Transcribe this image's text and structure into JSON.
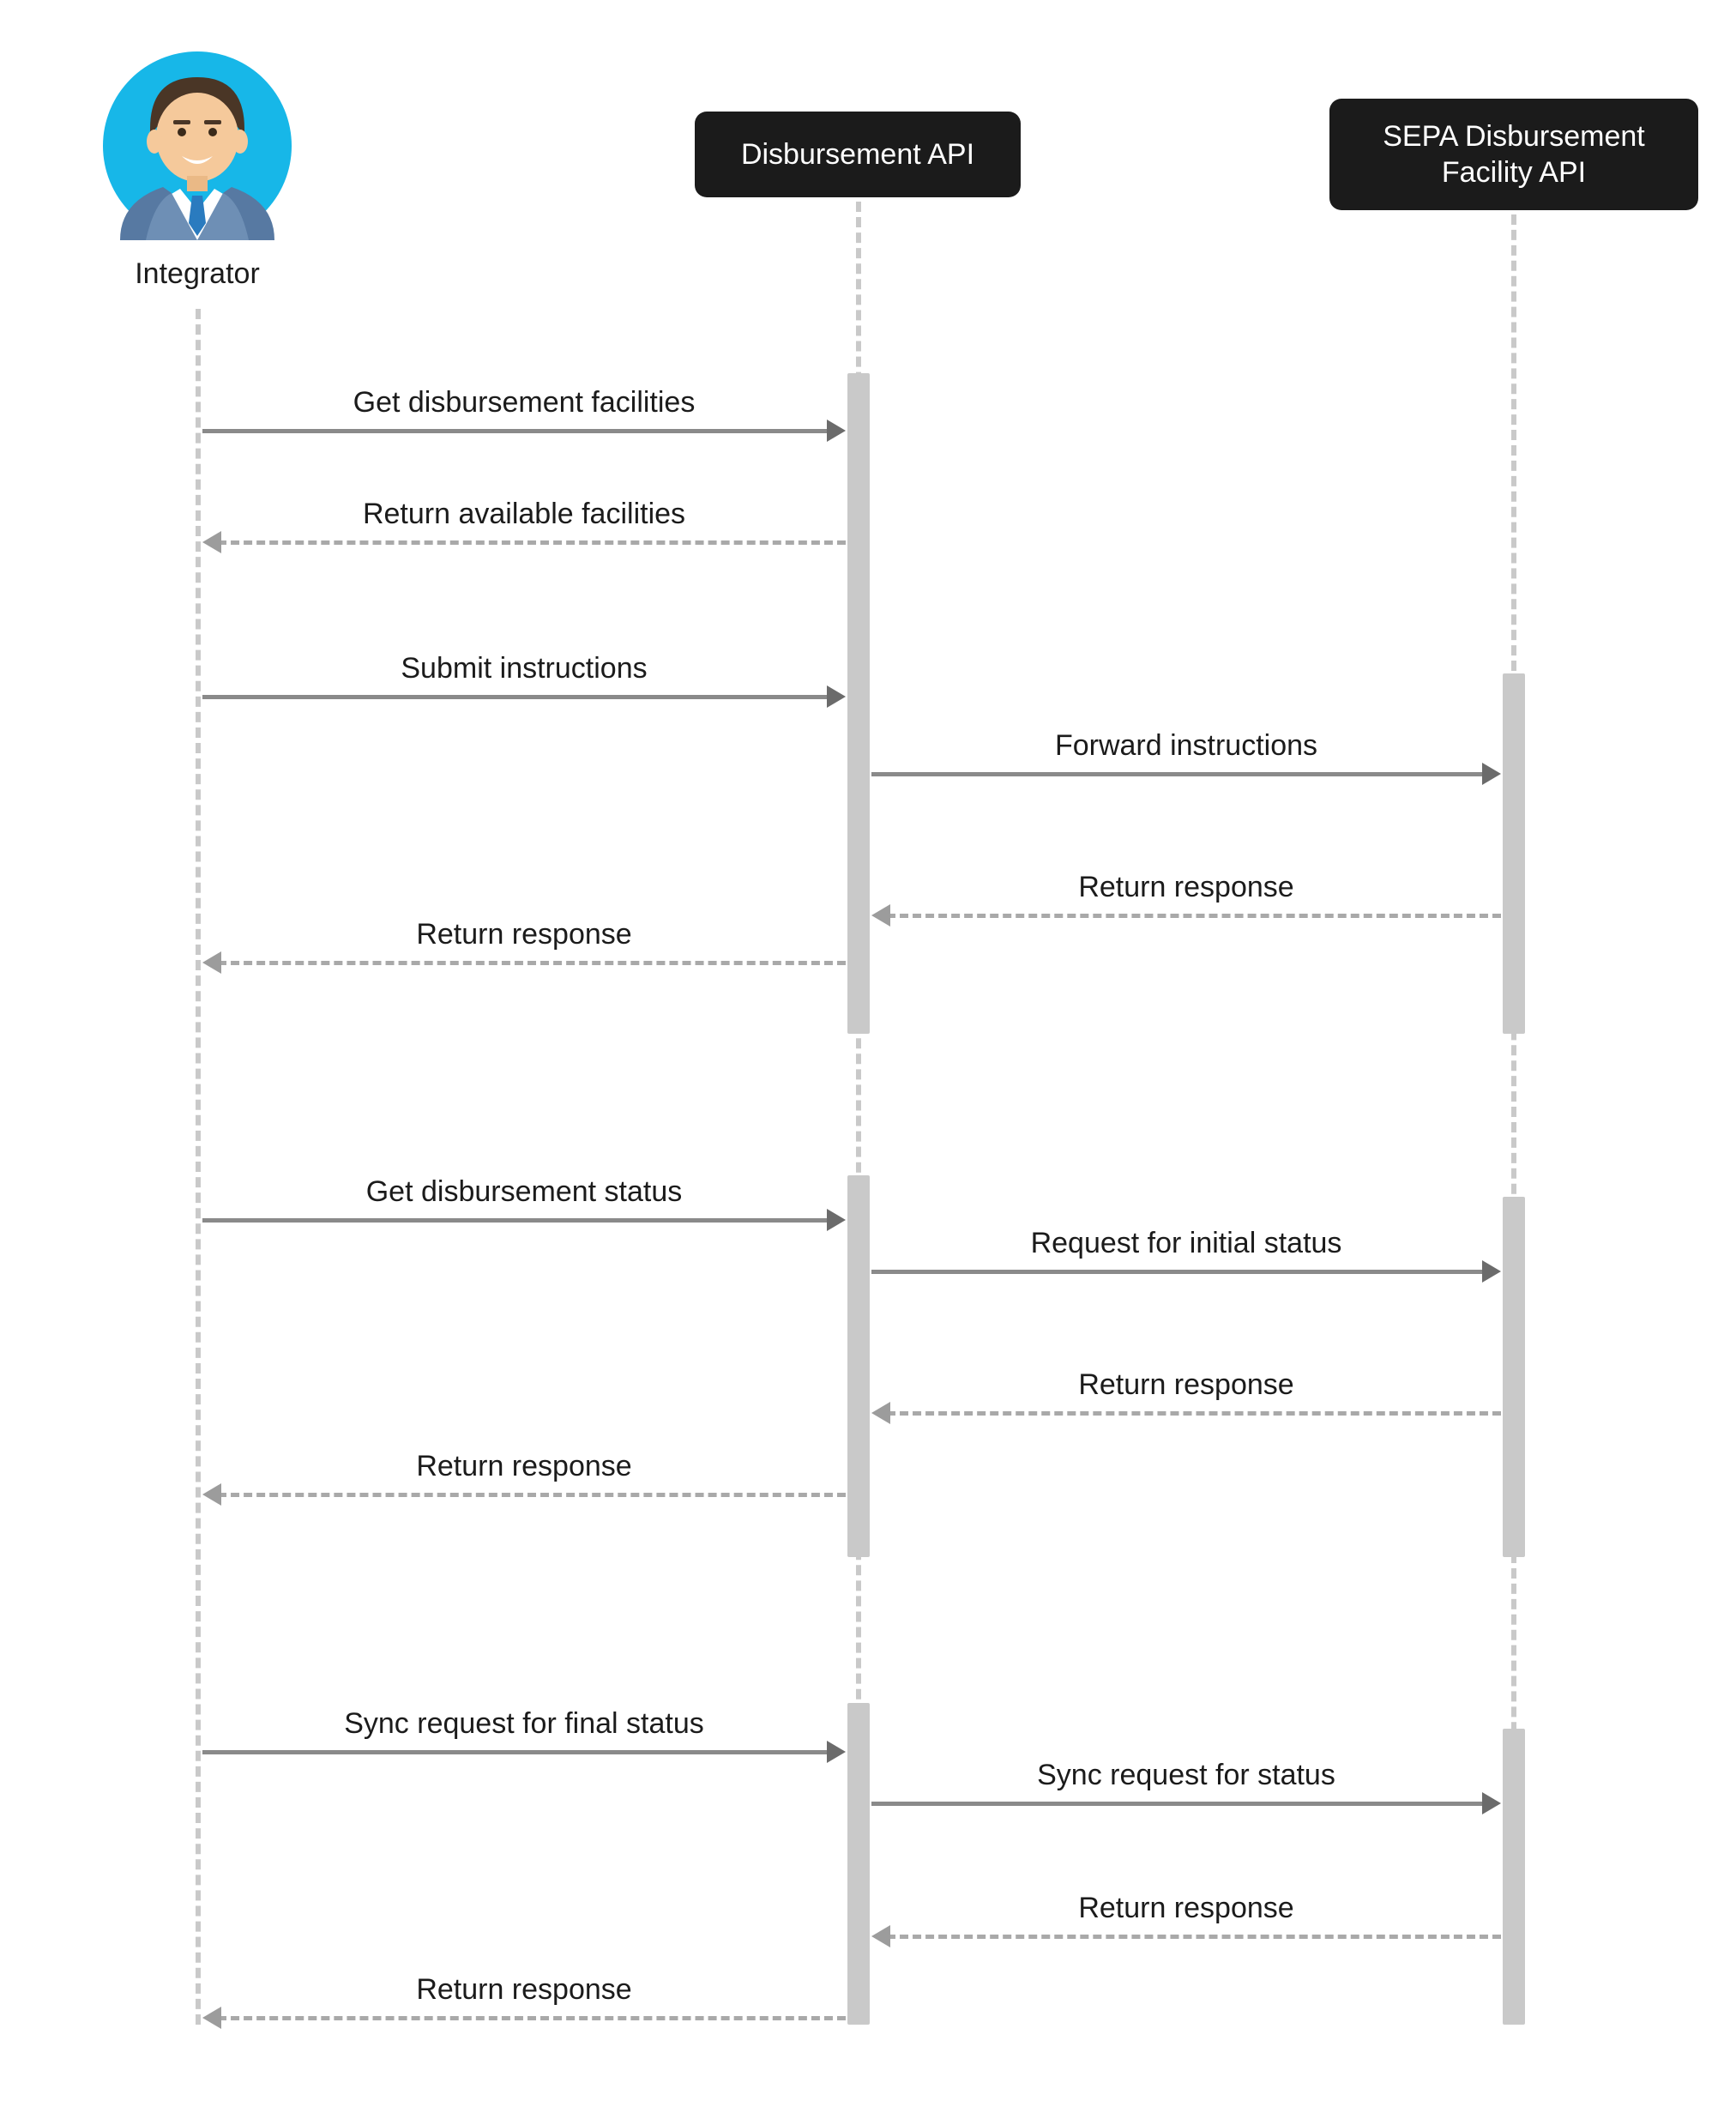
{
  "participants": {
    "integrator": {
      "label": "Integrator"
    },
    "disbursement_api": {
      "label": "Disbursement API"
    },
    "sepa_api": {
      "label": "SEPA Disbursement Facility API"
    }
  },
  "messages": [
    {
      "id": "m0",
      "from": "integrator",
      "to": "disbursement_api",
      "label": "Get disbursement facilities",
      "style": "solid",
      "dir": "right"
    },
    {
      "id": "m1",
      "from": "disbursement_api",
      "to": "integrator",
      "label": "Return available facilities",
      "style": "dashed",
      "dir": "left"
    },
    {
      "id": "m2",
      "from": "integrator",
      "to": "disbursement_api",
      "label": "Submit instructions",
      "style": "solid",
      "dir": "right"
    },
    {
      "id": "m3",
      "from": "disbursement_api",
      "to": "sepa_api",
      "label": "Forward instructions",
      "style": "solid",
      "dir": "right"
    },
    {
      "id": "m4",
      "from": "sepa_api",
      "to": "disbursement_api",
      "label": "Return response",
      "style": "dashed",
      "dir": "left"
    },
    {
      "id": "m5",
      "from": "disbursement_api",
      "to": "integrator",
      "label": "Return response",
      "style": "dashed",
      "dir": "left"
    },
    {
      "id": "m6",
      "from": "integrator",
      "to": "disbursement_api",
      "label": "Get disbursement status",
      "style": "solid",
      "dir": "right"
    },
    {
      "id": "m7",
      "from": "disbursement_api",
      "to": "sepa_api",
      "label": "Request for initial status",
      "style": "solid",
      "dir": "right"
    },
    {
      "id": "m8",
      "from": "sepa_api",
      "to": "disbursement_api",
      "label": "Return response",
      "style": "dashed",
      "dir": "left"
    },
    {
      "id": "m9",
      "from": "disbursement_api",
      "to": "integrator",
      "label": "Return response",
      "style": "dashed",
      "dir": "left"
    },
    {
      "id": "m10",
      "from": "integrator",
      "to": "disbursement_api",
      "label": "Sync request for final status",
      "style": "solid",
      "dir": "right"
    },
    {
      "id": "m11",
      "from": "disbursement_api",
      "to": "sepa_api",
      "label": "Sync request for status",
      "style": "solid",
      "dir": "right"
    },
    {
      "id": "m12",
      "from": "sepa_api",
      "to": "disbursement_api",
      "label": "Return response",
      "style": "dashed",
      "dir": "left"
    },
    {
      "id": "m13",
      "from": "disbursement_api",
      "to": "integrator",
      "label": "Return response",
      "style": "dashed",
      "dir": "left"
    }
  ]
}
